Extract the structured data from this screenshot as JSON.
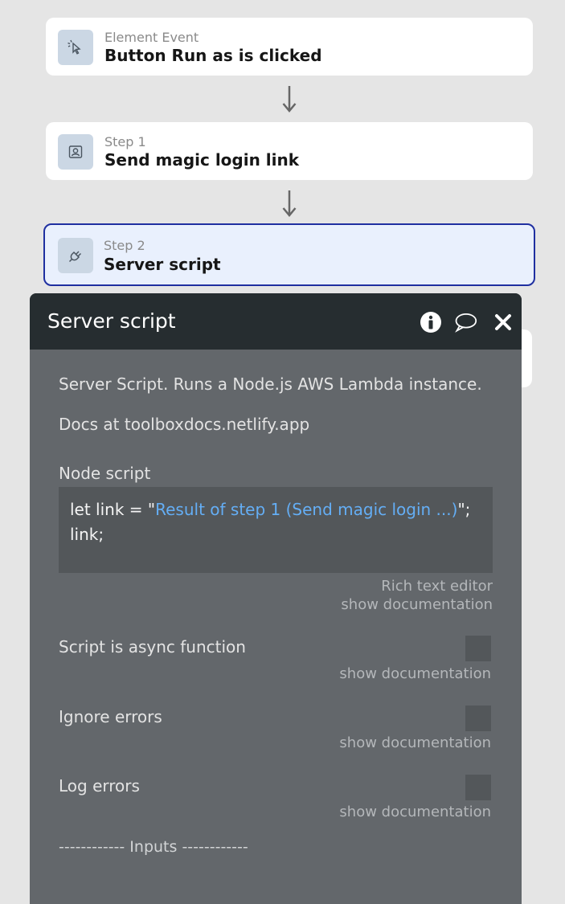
{
  "workflow": {
    "event": {
      "label": "Element Event",
      "title": "Button Run as is clicked",
      "icon": "cursor-click-icon"
    },
    "steps": [
      {
        "label": "Step 1",
        "title": "Send magic login link",
        "icon": "user-card-icon"
      },
      {
        "label": "Step 2",
        "title": "Server script",
        "icon": "plug-icon"
      }
    ]
  },
  "panel": {
    "title": "Server script",
    "header_icons": [
      "info-icon",
      "comment-icon",
      "close-icon"
    ],
    "description": "Server Script. Runs a Node.js AWS Lambda instance.",
    "docs_link": "Docs at toolboxdocs.netlify.app",
    "node_script": {
      "label": "Node script",
      "line1_prefix": "let link = \"",
      "line1_link": "Result of step 1 (Send magic login ...)",
      "line1_suffix": "\";",
      "line2": "link;",
      "rich_text_editor": "Rich text editor",
      "show_documentation": "show documentation"
    },
    "options": [
      {
        "label": "Script is async function",
        "checked": false,
        "show_documentation": "show documentation"
      },
      {
        "label": "Ignore errors",
        "checked": false,
        "show_documentation": "show documentation"
      },
      {
        "label": "Log errors",
        "checked": false,
        "show_documentation": "show documentation"
      }
    ],
    "inputs_divider": "------------ Inputs ------------"
  },
  "colors": {
    "background": "#e5e5e5",
    "selected_border": "#1f2fa0",
    "panel_header": "#262d30",
    "panel_body": "#63676b",
    "dynamic_link": "#64aef5"
  }
}
